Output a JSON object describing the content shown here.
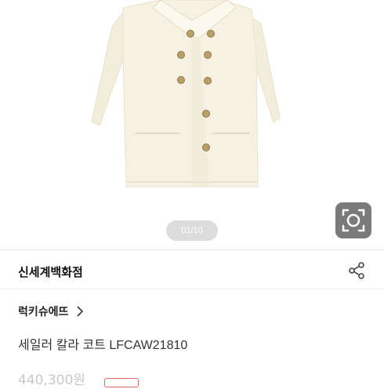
{
  "gallery": {
    "counter": "01/10",
    "image_subject": "coat-product-photo",
    "lens_icon": "camera-lens-search-icon"
  },
  "store": {
    "name": "신세계백화점",
    "share_icon": "share-icon"
  },
  "product": {
    "brand": "럭키슈에뜨",
    "title": "세일러 칼라 코트 LFCAW21810",
    "price": "440,300원"
  },
  "colors": {
    "coat": "#f6f1e2",
    "buttons": "#b9a06a",
    "badge_border": "#e06a6a",
    "pager_bg": "#dcdcdc",
    "lens_bg": "#7a7a7a"
  }
}
